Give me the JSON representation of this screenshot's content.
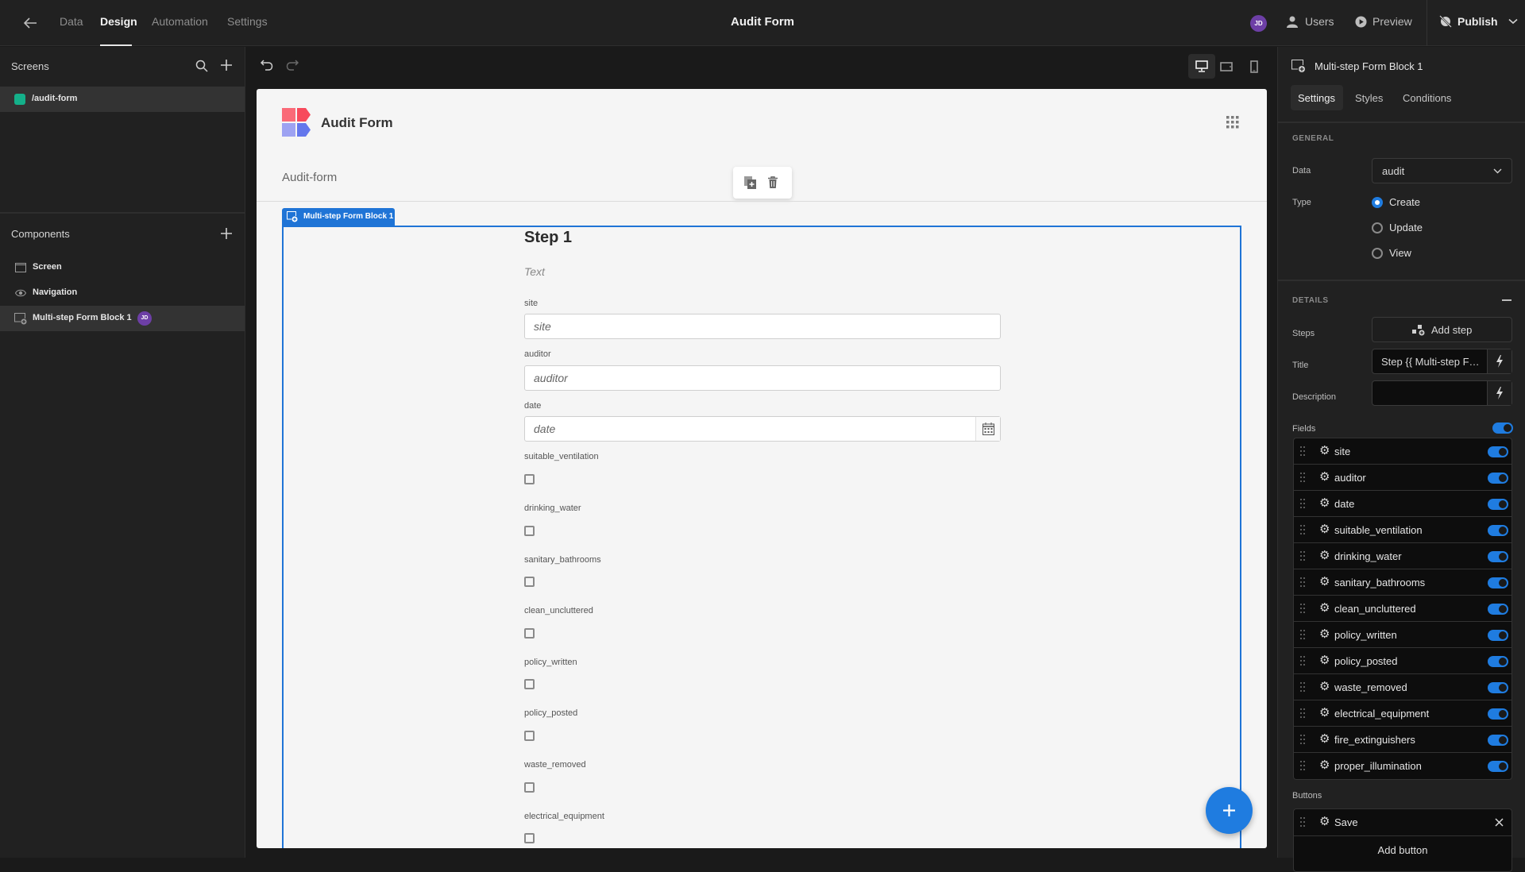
{
  "topbar": {
    "nav_tabs": [
      {
        "label": "Data",
        "active": false
      },
      {
        "label": "Design",
        "active": true
      },
      {
        "label": "Automation",
        "active": false
      },
      {
        "label": "Settings",
        "active": false
      }
    ],
    "app_title": "Audit Form",
    "user_initials": "JD",
    "users_label": "Users",
    "preview_label": "Preview",
    "publish_label": "Publish"
  },
  "left_panel": {
    "screens_title": "Screens",
    "screens": [
      {
        "route": "/audit-form",
        "color": "#14b08a",
        "selected": true
      }
    ],
    "components_title": "Components",
    "components": [
      {
        "label": "Screen",
        "icon": "screen-icon",
        "selected": false
      },
      {
        "label": "Navigation",
        "icon": "eye-icon",
        "selected": false
      },
      {
        "label": "Multi-step Form Block 1",
        "icon": "form-block-icon",
        "selected": true,
        "badge": "JD"
      }
    ]
  },
  "canvas": {
    "app_name": "Audit Form",
    "page_title": "Audit-form",
    "block_label": "Multi-step Form Block 1",
    "form": {
      "step_title": "Step 1",
      "description_placeholder": "Text",
      "text_fields": [
        {
          "label": "site",
          "placeholder": "site"
        },
        {
          "label": "auditor",
          "placeholder": "auditor"
        }
      ],
      "date_field": {
        "label": "date",
        "placeholder": "date"
      },
      "checkbox_fields": [
        {
          "label": "suitable_ventilation",
          "checked": false
        },
        {
          "label": "drinking_water",
          "checked": false
        },
        {
          "label": "sanitary_bathrooms",
          "checked": false
        },
        {
          "label": "clean_uncluttered",
          "checked": false
        },
        {
          "label": "policy_written",
          "checked": false
        },
        {
          "label": "policy_posted",
          "checked": false
        },
        {
          "label": "waste_removed",
          "checked": false
        },
        {
          "label": "electrical_equipment",
          "checked": false
        }
      ]
    }
  },
  "right_panel": {
    "component_name": "Multi-step Form Block 1",
    "tabs": [
      {
        "label": "Settings",
        "active": true
      },
      {
        "label": "Styles",
        "active": false
      },
      {
        "label": "Conditions",
        "active": false
      }
    ],
    "general": {
      "section_title": "GENERAL",
      "data_label": "Data",
      "data_value": "audit",
      "type_label": "Type",
      "type_options": [
        {
          "label": "Create",
          "selected": true
        },
        {
          "label": "Update",
          "selected": false
        },
        {
          "label": "View",
          "selected": false
        }
      ]
    },
    "details": {
      "section_title": "DETAILS",
      "steps_label": "Steps",
      "add_step_label": "Add step",
      "title_label": "Title",
      "title_value": "Step {{ Multi-step F…",
      "description_label": "Description",
      "description_value": "",
      "fields_label": "Fields",
      "fields_toggle": true,
      "fields": [
        {
          "name": "site",
          "enabled": true
        },
        {
          "name": "auditor",
          "enabled": true
        },
        {
          "name": "date",
          "enabled": true
        },
        {
          "name": "suitable_ventilation",
          "enabled": true
        },
        {
          "name": "drinking_water",
          "enabled": true
        },
        {
          "name": "sanitary_bathrooms",
          "enabled": true
        },
        {
          "name": "clean_uncluttered",
          "enabled": true
        },
        {
          "name": "policy_written",
          "enabled": true
        },
        {
          "name": "policy_posted",
          "enabled": true
        },
        {
          "name": "waste_removed",
          "enabled": true
        },
        {
          "name": "electrical_equipment",
          "enabled": true
        },
        {
          "name": "fire_extinguishers",
          "enabled": true
        },
        {
          "name": "proper_illumination",
          "enabled": true
        }
      ],
      "buttons_label": "Buttons",
      "buttons": [
        {
          "label": "Save"
        }
      ],
      "add_button_label": "Add button"
    }
  },
  "colors": {
    "accent": "#1f7ce0",
    "avatar": "#6d3fa6",
    "screen_dot": "#14b08a"
  }
}
